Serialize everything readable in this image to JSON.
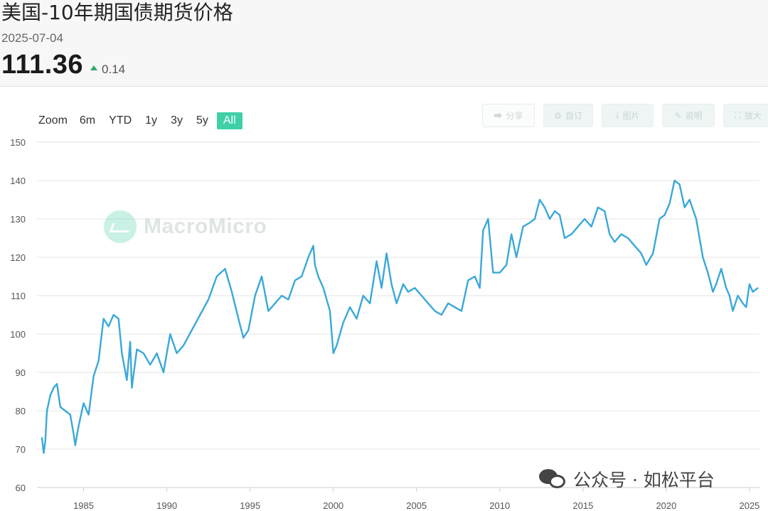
{
  "header": {
    "title": "美国-10年期国债期货价格",
    "date": "2025-07-04",
    "price": "111.36",
    "change": "0.14",
    "change_direction": "up",
    "change_color": "#2fa86a"
  },
  "range_selector": {
    "label": "Zoom",
    "buttons": [
      "6m",
      "YTD",
      "1y",
      "3y",
      "5y",
      "All"
    ],
    "active": "All",
    "active_color": "#3fd0a8"
  },
  "toolbar": {
    "share": "分享",
    "custom": "自订",
    "image": "图片",
    "note": "说明",
    "enlarge": "放大"
  },
  "watermark": {
    "brand": "MacroMicro"
  },
  "source_footer": "公众号 · 如松平台",
  "chart_data": {
    "type": "line",
    "title": "",
    "xlabel": "",
    "ylabel": "",
    "ylim": [
      60,
      150
    ],
    "yticks": [
      60,
      70,
      80,
      90,
      100,
      110,
      120,
      130,
      140,
      150
    ],
    "xlim": [
      1982.2,
      2025.6
    ],
    "xticks": [
      1985,
      1990,
      1995,
      2000,
      2005,
      2010,
      2015,
      2020,
      2025
    ],
    "grid": true,
    "legend": "none",
    "series": [
      {
        "name": "",
        "color": "#3aa8d8",
        "x": [
          1982.5,
          1982.6,
          1982.7,
          1982.8,
          1983.0,
          1983.2,
          1983.4,
          1983.6,
          1983.9,
          1984.2,
          1984.4,
          1984.5,
          1984.7,
          1985.0,
          1985.3,
          1985.6,
          1985.9,
          1986.2,
          1986.5,
          1986.8,
          1987.1,
          1987.3,
          1987.6,
          1987.8,
          1987.9,
          1988.2,
          1988.6,
          1989.0,
          1989.4,
          1989.8,
          1990.2,
          1990.6,
          1991.0,
          1991.5,
          1992.0,
          1992.5,
          1993.0,
          1993.5,
          1993.9,
          1994.3,
          1994.6,
          1994.9,
          1995.3,
          1995.7,
          1996.1,
          1996.5,
          1996.9,
          1997.3,
          1997.7,
          1998.1,
          1998.5,
          1998.8,
          1998.9,
          1999.1,
          1999.4,
          1999.8,
          2000.0,
          2000.2,
          2000.6,
          2001.0,
          2001.4,
          2001.8,
          2002.2,
          2002.6,
          2002.9,
          2003.2,
          2003.5,
          2003.8,
          2004.2,
          2004.5,
          2004.9,
          2005.3,
          2005.7,
          2006.1,
          2006.5,
          2006.9,
          2007.3,
          2007.7,
          2008.1,
          2008.5,
          2008.8,
          2009.0,
          2009.3,
          2009.6,
          2010.0,
          2010.4,
          2010.7,
          2011.0,
          2011.4,
          2011.8,
          2012.1,
          2012.4,
          2012.7,
          2013.0,
          2013.3,
          2013.6,
          2013.9,
          2014.3,
          2014.7,
          2015.1,
          2015.5,
          2015.9,
          2016.3,
          2016.6,
          2016.9,
          2017.3,
          2017.7,
          2018.1,
          2018.5,
          2018.8,
          2019.2,
          2019.6,
          2019.9,
          2020.2,
          2020.5,
          2020.8,
          2021.1,
          2021.4,
          2021.8,
          2022.2,
          2022.5,
          2022.8,
          2023.0,
          2023.3,
          2023.6,
          2023.8,
          2024.0,
          2024.3,
          2024.6,
          2024.8,
          2025.0,
          2025.2,
          2025.5
        ],
        "y": [
          73,
          69,
          72,
          80,
          84,
          86,
          87,
          81,
          80,
          79,
          74,
          71,
          76,
          82,
          79,
          89,
          93,
          104,
          102,
          105,
          104,
          95,
          88,
          98,
          86,
          96,
          95,
          92,
          95,
          90,
          100,
          95,
          97,
          101,
          105,
          109,
          115,
          117,
          111,
          104,
          99,
          101,
          110,
          115,
          106,
          108,
          110,
          109,
          114,
          115,
          120,
          123,
          118,
          115,
          112,
          106,
          95,
          97,
          103,
          107,
          104,
          110,
          108,
          119,
          112,
          121,
          113,
          108,
          113,
          111,
          112,
          110,
          108,
          106,
          105,
          108,
          107,
          106,
          114,
          115,
          112,
          127,
          130,
          116,
          116,
          118,
          126,
          120,
          128,
          129,
          130,
          135,
          133,
          130,
          132,
          131,
          125,
          126,
          128,
          130,
          128,
          133,
          132,
          126,
          124,
          126,
          125,
          123,
          121,
          118,
          121,
          130,
          131,
          134,
          140,
          139,
          133,
          135,
          130,
          120,
          116,
          111,
          113,
          117,
          112,
          110,
          106,
          110,
          108,
          107,
          113,
          111,
          112
        ]
      }
    ]
  }
}
